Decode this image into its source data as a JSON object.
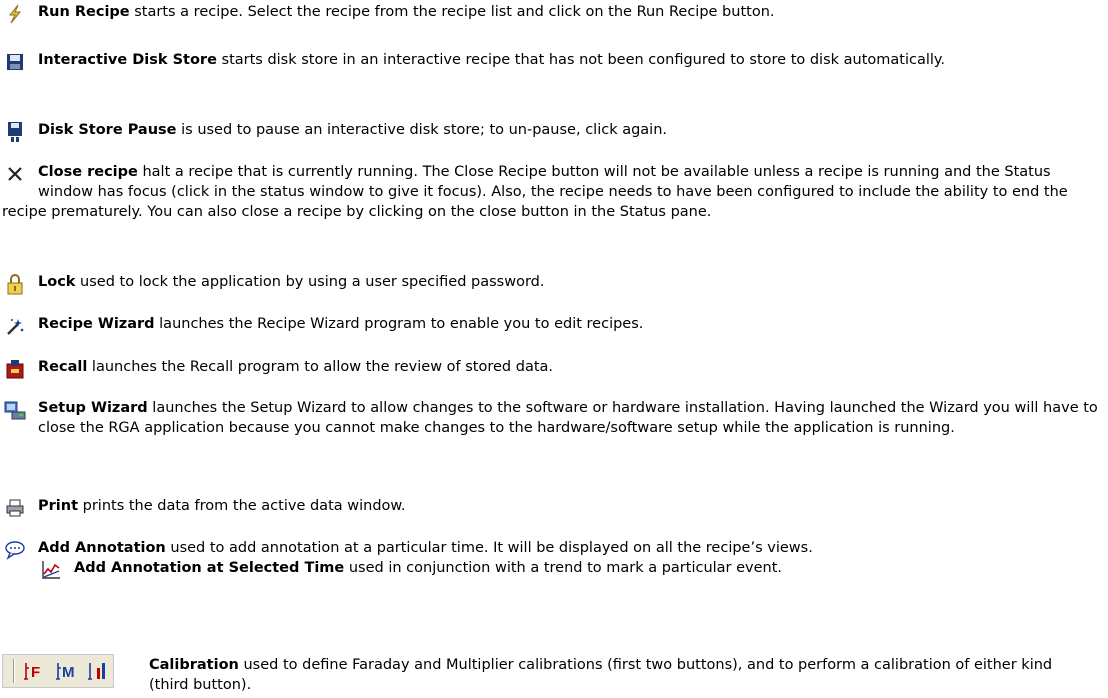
{
  "entries": [
    {
      "icon": "lightning-icon",
      "title": "Run Recipe",
      "text": " starts a recipe. Select the recipe from the recipe list and click on the Run Recipe button."
    },
    {
      "icon": "floppy-disk-icon",
      "title": "Interactive Disk Store",
      "text": " starts disk store in an interactive recipe that has not been configured to store to disk automatically."
    },
    {
      "icon": "disk-pause-icon",
      "title": "Disk Store Pause",
      "text": " is used to pause an interactive disk store; to un-pause, click again."
    },
    {
      "icon": "close-icon",
      "title": "Close recipe",
      "text": " halt a recipe that is currently running. The Close Recipe button will not be available unless a recipe is running and the Status window has focus (click in the status window to give it focus). Also, the recipe needs to have been configured to include the ability to end the recipe prematurely. You can also close a recipe by clicking on the close button in the Status pane."
    },
    {
      "icon": "lock-icon",
      "title": "Lock",
      "text": " used to lock the application by using a user specified password."
    },
    {
      "icon": "wizard-wand-icon",
      "title": "Recipe Wizard",
      "text": " launches the Recipe Wizard program to enable you to edit recipes."
    },
    {
      "icon": "recall-icon",
      "title": "Recall",
      "text": " launches the Recall program to allow the review of stored data."
    },
    {
      "icon": "setup-wizard-icon",
      "title": "Setup Wizard",
      "text": " launches the Setup Wizard to allow changes to the software or hardware installation. Having launched the Wizard you will have to close the RGA application because you cannot make changes to the hardware/software setup while the application is running."
    },
    {
      "icon": "printer-icon",
      "title": "Print",
      "text": " prints the data from the active data window."
    },
    {
      "icon": "speech-bubble-icon",
      "title": "Add Annotation",
      "text": " used to add annotation at a particular time. It will be displayed on all the recipe’s views."
    }
  ],
  "sub_entry": {
    "icon": "annotation-chart-icon",
    "title": "Add Annotation at Selected Time",
    "text": " used in conjunction with a trend to mark a particular event."
  },
  "calibration": {
    "buttons": [
      {
        "label": "F",
        "icon": "faraday-icon"
      },
      {
        "label": "M",
        "icon": "multiplier-icon"
      },
      {
        "label": "",
        "icon": "calibrate-icon"
      }
    ],
    "title": "Calibration",
    "text": " used to define Faraday and Multiplier calibrations (first two buttons), and to perform a calibration of either kind (third button)."
  },
  "colors": {
    "text": "#000000",
    "icon_red": "#c00000",
    "icon_blue": "#1a3fa0",
    "toolbar_bg": "#ece9d8"
  }
}
